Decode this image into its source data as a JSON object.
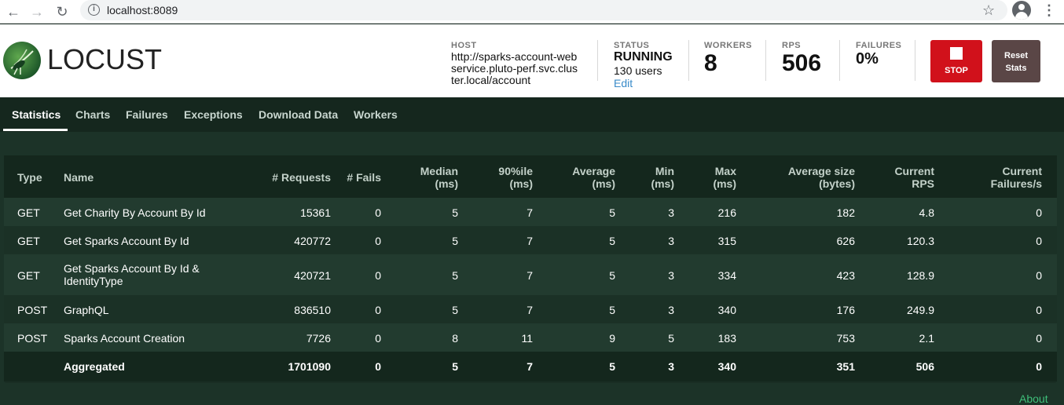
{
  "browser": {
    "url": "localhost:8089"
  },
  "app": {
    "logo_text": "LOCUST"
  },
  "stats_bar": {
    "host_label": "HOST",
    "host_value": "http://sparks-account-webservice.pluto-perf.svc.cluster.local/account",
    "status_label": "STATUS",
    "status_value": "RUNNING",
    "users": "130 users",
    "edit_label": "Edit",
    "workers_label": "WORKERS",
    "workers_value": "8",
    "rps_label": "RPS",
    "rps_value": "506",
    "failures_label": "FAILURES",
    "failures_value": "0%",
    "stop_label": "STOP",
    "reset_label_line1": "Reset",
    "reset_label_line2": "Stats"
  },
  "tabs": [
    "Statistics",
    "Charts",
    "Failures",
    "Exceptions",
    "Download Data",
    "Workers"
  ],
  "table": {
    "headers": {
      "type": "Type",
      "name": "Name",
      "requests": "# Requests",
      "fails": "# Fails",
      "median_1": "Median",
      "median_2": "(ms)",
      "p90_1": "90%ile",
      "p90_2": "(ms)",
      "avg_1": "Average",
      "avg_2": "(ms)",
      "min_1": "Min",
      "min_2": "(ms)",
      "max_1": "Max",
      "max_2": "(ms)",
      "size_1": "Average size",
      "size_2": "(bytes)",
      "rps_1": "Current",
      "rps_2": "RPS",
      "fps_1": "Current",
      "fps_2": "Failures/s"
    },
    "rows": [
      {
        "type": "GET",
        "name": "Get Charity By Account By Id",
        "name2": "",
        "requests": "15361",
        "fails": "0",
        "median": "5",
        "p90": "7",
        "avg": "5",
        "min": "3",
        "max": "216",
        "size": "182",
        "rps": "4.8",
        "fps": "0"
      },
      {
        "type": "GET",
        "name": "Get Sparks Account By Id",
        "name2": "",
        "requests": "420772",
        "fails": "0",
        "median": "5",
        "p90": "7",
        "avg": "5",
        "min": "3",
        "max": "315",
        "size": "626",
        "rps": "120.3",
        "fps": "0"
      },
      {
        "type": "GET",
        "name": "Get Sparks Account By Id &",
        "name2": "IdentityType",
        "requests": "420721",
        "fails": "0",
        "median": "5",
        "p90": "7",
        "avg": "5",
        "min": "3",
        "max": "334",
        "size": "423",
        "rps": "128.9",
        "fps": "0"
      },
      {
        "type": "POST",
        "name": "GraphQL",
        "name2": "",
        "requests": "836510",
        "fails": "0",
        "median": "5",
        "p90": "7",
        "avg": "5",
        "min": "3",
        "max": "340",
        "size": "176",
        "rps": "249.9",
        "fps": "0"
      },
      {
        "type": "POST",
        "name": "Sparks Account Creation",
        "name2": "",
        "requests": "7726",
        "fails": "0",
        "median": "8",
        "p90": "11",
        "avg": "9",
        "min": "5",
        "max": "183",
        "size": "753",
        "rps": "2.1",
        "fps": "0"
      }
    ],
    "aggregated": {
      "type": "",
      "name": "Aggregated",
      "requests": "1701090",
      "fails": "0",
      "median": "5",
      "p90": "7",
      "avg": "5",
      "min": "3",
      "max": "340",
      "size": "351",
      "rps": "506",
      "fps": "0"
    }
  },
  "footer": {
    "about": "About"
  },
  "colors": {
    "stop_button": "#d1111b",
    "reset_button": "#5a4646",
    "background": "#1c3328",
    "link": "#3fbf7a"
  },
  "icons": [
    "back-arrow-icon",
    "forward-arrow-icon",
    "reload-icon",
    "info-icon",
    "star-icon",
    "profile-icon",
    "kebab-menu-icon",
    "locust-logo-icon",
    "stop-icon"
  ]
}
